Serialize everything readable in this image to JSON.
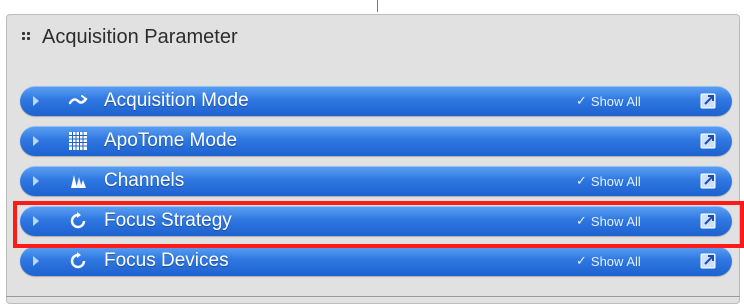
{
  "panel": {
    "title": "Acquisition Parameter"
  },
  "rows": [
    {
      "label": "Acquisition Mode",
      "icon": "acquisition-mode-icon",
      "show_all": "Show All",
      "has_show_all": true
    },
    {
      "label": "ApoTome Mode",
      "icon": "grid-icon",
      "show_all": "",
      "has_show_all": false
    },
    {
      "label": "Channels",
      "icon": "channels-icon",
      "show_all": "Show All",
      "has_show_all": true
    },
    {
      "label": "Focus Strategy",
      "icon": "focus-icon",
      "show_all": "Show All",
      "has_show_all": true,
      "highlighted": true
    },
    {
      "label": "Focus Devices",
      "icon": "focus-icon",
      "show_all": "Show All",
      "has_show_all": true
    }
  ],
  "colors": {
    "row_blue": "#2f78e2",
    "highlight": "#ff1a1a",
    "panel_bg": "#e1e1e1"
  }
}
